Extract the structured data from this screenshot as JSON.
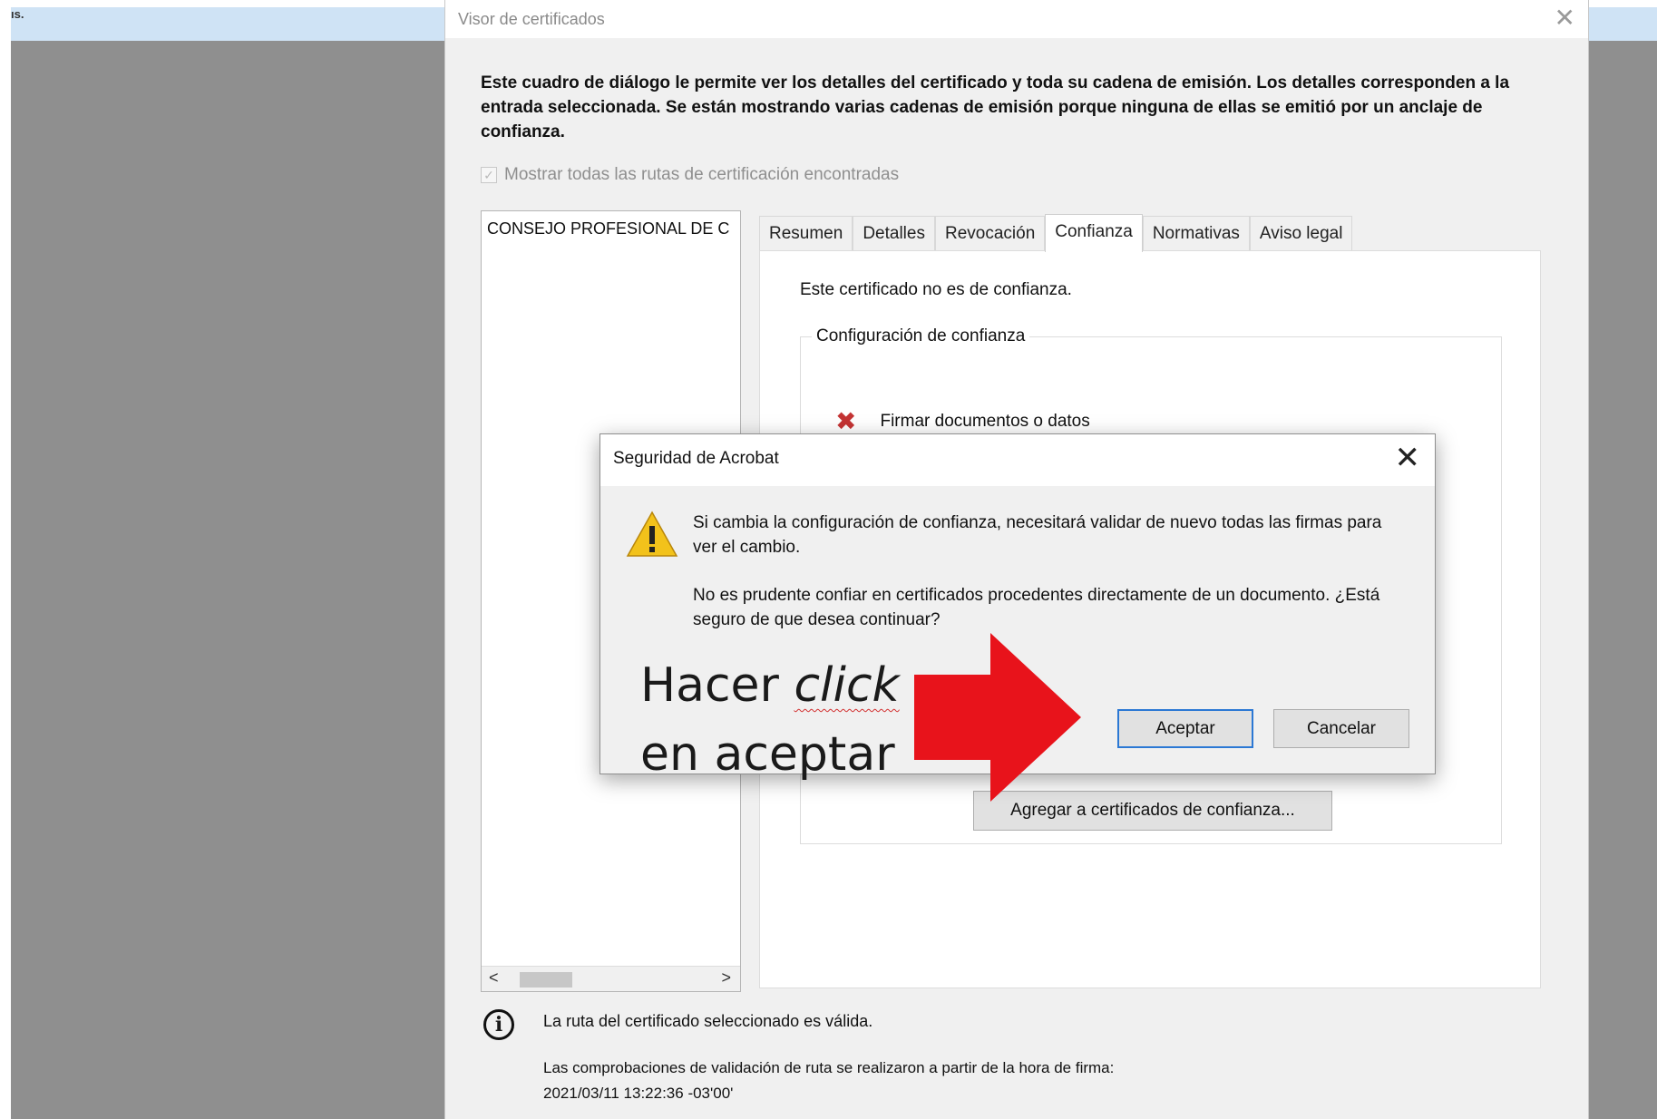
{
  "background": {
    "title_fragment": "ıs."
  },
  "viewer": {
    "title": "Visor de certificados",
    "close_glyph": "✕",
    "intro": "Este cuadro de diálogo le permite ver los detalles del certificado y toda su cadena de emisión. Los detalles corresponden a la entrada seleccionada. Se están mostrando varias cadenas de emisión porque ninguna de ellas se emitió por un anclaje de confianza.",
    "show_all_paths": {
      "label": "Mostrar todas las rutas de certificación encontradas",
      "checked": true,
      "enabled": false
    },
    "tree": {
      "items": [
        {
          "label": "CONSEJO PROFESIONAL DE C"
        }
      ],
      "scroll_left": "<",
      "scroll_right": ">"
    },
    "tabs": [
      {
        "label": "Resumen",
        "active": false
      },
      {
        "label": "Detalles",
        "active": false
      },
      {
        "label": "Revocación",
        "active": false
      },
      {
        "label": "Confianza",
        "active": true
      },
      {
        "label": "Normativas",
        "active": false
      },
      {
        "label": "Aviso legal",
        "active": false
      }
    ],
    "trust_panel": {
      "status": "Este certificado no es de confianza.",
      "group_label": "Configuración de confianza",
      "items": [
        {
          "label": "Firmar documentos o datos",
          "icon": "x-icon",
          "trusted": false
        }
      ],
      "add_button": "Agregar a certificados de confianza..."
    },
    "info": {
      "icon": "info-icon",
      "valid": "La ruta del certificado seleccionado es válida.",
      "checks": "Las comprobaciones de validación de ruta se realizaron a partir de la hora de firma:",
      "date": "2021/03/11 13:22:36 -03'00'"
    }
  },
  "security_dialog": {
    "title": "Seguridad de Acrobat",
    "close_glyph": "✕",
    "icon": "warning-icon",
    "message1": "Si cambia la configuración de confianza, necesitará validar de nuevo todas las firmas para ver el cambio.",
    "message2": "No es prudente confiar en certificados procedentes directamente de un documento. ¿Está seguro de que desea continuar?",
    "ok_button": "Aceptar",
    "cancel_button": "Cancelar"
  },
  "annotation": {
    "line1_prefix": "Hacer ",
    "line1_emphasis": "click",
    "line2": "en aceptar",
    "arrow_color": "#e8131b"
  },
  "colors": {
    "accent": "#2b78d4",
    "error": "#c43434",
    "warning": "#f2c21b",
    "annotation": "#e8131b"
  }
}
